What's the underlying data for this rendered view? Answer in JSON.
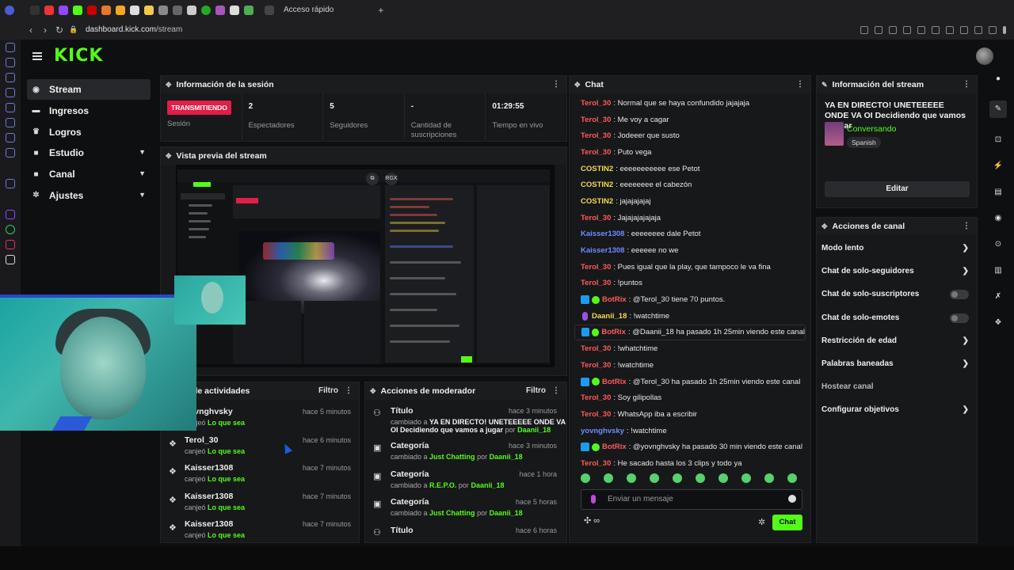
{
  "browser": {
    "tab_label": "Acceso rápido",
    "url_host": "dashboard.kick.com",
    "url_path": "/stream"
  },
  "app": {
    "logo": "KICK"
  },
  "sidebar": {
    "items": [
      {
        "label": "Stream",
        "icon": "stream-icon",
        "active": true
      },
      {
        "label": "Ingresos",
        "icon": "money-icon"
      },
      {
        "label": "Logros",
        "icon": "trophy-icon"
      },
      {
        "label": "Estudio",
        "icon": "video-icon",
        "expandable": true
      },
      {
        "label": "Canal",
        "icon": "video-icon",
        "expandable": true
      },
      {
        "label": "Ajustes",
        "icon": "gear-icon",
        "expandable": true
      }
    ]
  },
  "session": {
    "title": "Información de la sesión",
    "status_badge": "TRANSMITIENDO",
    "status_label": "Sesión",
    "viewers_value": "2",
    "viewers_label": "Espectadores",
    "followers_value": "5",
    "followers_label": "Seguidores",
    "subs_value": "-",
    "subs_label": "Cantidad de suscripciones",
    "live_time_value": "01:29:55",
    "live_time_label": "Tiempo en vivo"
  },
  "preview": {
    "title": "Vista previa del stream",
    "rgx_label": "RGX"
  },
  "activity": {
    "title": "de actividades",
    "filter": "Filtro",
    "rows": [
      {
        "name": "yovnghvsky",
        "action": "canjeó",
        "reward": "Lo que sea",
        "time": "hace 5 minutos"
      },
      {
        "name": "Terol_30",
        "action": "canjeó",
        "reward": "Lo que sea",
        "time": "hace 6 minutos"
      },
      {
        "name": "Kaisser1308",
        "action": "canjeó",
        "reward": "Lo que sea",
        "time": "hace 7 minutos"
      },
      {
        "name": "Kaisser1308",
        "action": "canjeó",
        "reward": "Lo que sea",
        "time": "hace 7 minutos"
      },
      {
        "name": "Kaisser1308",
        "action": "canjeó",
        "reward": "Lo que sea",
        "time": "hace 7 minutos"
      }
    ]
  },
  "moderator": {
    "title": "Acciones de moderador",
    "filter": "Filtro",
    "rows": [
      {
        "name": "Título",
        "prefix": "cambiado a",
        "value": "YA EN DIRECTO! UNETEEEEE ONDE VA OI Decidiendo que vamos a jugar",
        "by": "por",
        "user": "Daanii_18",
        "time": "hace 3 minutos"
      },
      {
        "name": "Categoría",
        "prefix": "cambiado a",
        "value": "Just Chatting",
        "by": "por",
        "user": "Daanii_18",
        "time": "hace 3 minutos"
      },
      {
        "name": "Categoría",
        "prefix": "cambiado a",
        "value": "R.E.P.O.",
        "by": "por",
        "user": "Daanii_18",
        "time": "hace 1 hora"
      },
      {
        "name": "Categoría",
        "prefix": "cambiado a",
        "value": "Just Chatting",
        "by": "por",
        "user": "Daanii_18",
        "time": "hace 5 horas"
      },
      {
        "name": "Título",
        "time": "hace 6 horas"
      }
    ]
  },
  "chat": {
    "title": "Chat",
    "messages": [
      {
        "user": "Terol_30",
        "text": ": Normal que se haya confundido jajajaja",
        "color": "#ff5a5a"
      },
      {
        "user": "Terol_30",
        "text": ": Me voy a cagar",
        "color": "#ff5a5a"
      },
      {
        "user": "Terol_30",
        "text": ": Jodeeer que susto",
        "color": "#ff5a5a"
      },
      {
        "user": "Terol_30",
        "text": ": Puto vega",
        "color": "#ff5a5a"
      },
      {
        "user": "COSTIN2",
        "text": ": eeeeeeeeeee ese Petot",
        "color": "#f2d94e"
      },
      {
        "user": "COSTIN2",
        "text": ": eeeeeeee el cabezón",
        "color": "#f2d94e"
      },
      {
        "user": "COSTIN2",
        "text": ": jajajajajaj",
        "color": "#f2d94e"
      },
      {
        "user": "Terol_30",
        "text": ": Jajajajajajaja",
        "color": "#ff5a5a"
      },
      {
        "user": "Kaisser1308",
        "text": ": eeeeeeee dale Petot",
        "color": "#6c8cff"
      },
      {
        "user": "Kaisser1308",
        "text": ": eeeeee no we",
        "color": "#6c8cff"
      },
      {
        "user": "Terol_30",
        "text": ": Pues igual que la play, que tampoco le va fina",
        "color": "#ff5a5a"
      },
      {
        "user": "Terol_30",
        "text": ": !puntos",
        "color": "#ff5a5a"
      },
      {
        "user": "BotRix",
        "text": ": @Terol_30 tiene 70 puntos.",
        "color": "#ff5a5a",
        "bot": true
      },
      {
        "user": "Daanii_18",
        "text": ": !watchtime",
        "color": "#f2d94e",
        "mic": true
      },
      {
        "user": "BotRix",
        "text": ": @Daanii_18 ha pasado 1h 25min viendo este canal",
        "color": "#ff5a5a",
        "bot": true,
        "highlight": true
      },
      {
        "user": "Terol_30",
        "text": ": !whatchtime",
        "color": "#ff5a5a"
      },
      {
        "user": "Terol_30",
        "text": ": !watchtime",
        "color": "#ff5a5a"
      },
      {
        "user": "BotRix",
        "text": ": @Terol_30 ha pasado 1h 25min viendo este canal",
        "color": "#ff5a5a",
        "bot": true
      },
      {
        "user": "Terol_30",
        "text": ": Soy gilipollas",
        "color": "#ff5a5a"
      },
      {
        "user": "Terol_30",
        "text": ": WhatsApp iba a escribir",
        "color": "#ff5a5a"
      },
      {
        "user": "yovnghvsky",
        "text": ": !watchtime",
        "color": "#6c8cff"
      },
      {
        "user": "BotRix",
        "text": ": @yovnghvsky ha pasado 30 min viendo este canal",
        "color": "#ff5a5a",
        "bot": true
      },
      {
        "user": "Terol_30",
        "text": ": He sacado hasta los 3 clips y todo ya",
        "color": "#ff5a5a"
      }
    ],
    "input_placeholder": "Enviar un mensaje",
    "send_label": "Chat"
  },
  "stream_info": {
    "title": "Información del stream",
    "stream_title": "YA EN DIRECTO! UNETEEEEE ONDE VA OI Decidiendo que vamos a jugar",
    "category": "Conversando",
    "language": "Spanish",
    "edit_label": "Editar"
  },
  "channel_actions": {
    "title": "Acciones de canal",
    "items": [
      {
        "label": "Modo lento",
        "type": "arrow"
      },
      {
        "label": "Chat de solo-seguidores",
        "type": "arrow"
      },
      {
        "label": "Chat de solo-suscriptores",
        "type": "toggle"
      },
      {
        "label": "Chat de solo-emotes",
        "type": "toggle"
      },
      {
        "label": "Restricción de edad",
        "type": "arrow"
      },
      {
        "label": "Palabras baneadas",
        "type": "arrow"
      },
      {
        "label": "Hostear canal",
        "type": "none"
      },
      {
        "label": "Configurar objetivos",
        "type": "arrow"
      }
    ]
  },
  "colors": {
    "accent": "#53fc18",
    "live": "#e11d48"
  }
}
